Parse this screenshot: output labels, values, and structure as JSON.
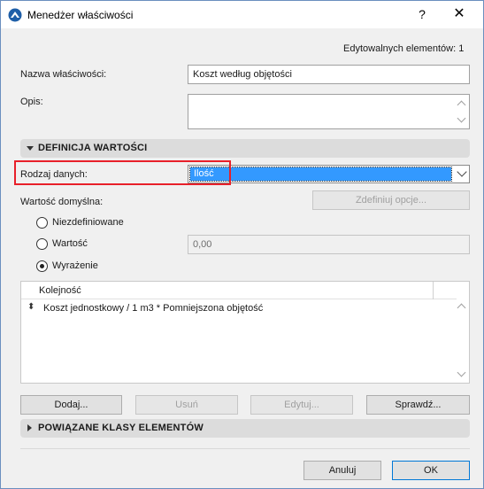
{
  "window": {
    "title": "Menedżer właściwości",
    "help_label": "?",
    "close_label": "✕"
  },
  "editable_count": "Edytowalnych elementów: 1",
  "property_name": {
    "label": "Nazwa właściwości:",
    "value": "Koszt według objętości"
  },
  "description": {
    "label": "Opis:",
    "value": ""
  },
  "section_value_definition": {
    "label": "DEFINICJA WARTOŚCI"
  },
  "data_type": {
    "label": "Rodzaj danych:",
    "value": "Ilość"
  },
  "default_value": {
    "label": "Wartość domyślna:",
    "define_options_button": "Zdefiniuj opcje...",
    "options": [
      {
        "label": "Niezdefiniowane",
        "selected": false
      },
      {
        "label": "Wartość",
        "selected": false
      },
      {
        "label": "Wyrażenie",
        "selected": true
      }
    ],
    "value_input": "0,00"
  },
  "order_list": {
    "column_header": "Kolejność",
    "rows": [
      {
        "text": "Koszt jednostkowy / 1 m3 * Pomniejszona objętość"
      }
    ]
  },
  "list_buttons": {
    "add": "Dodaj...",
    "remove": "Usuń",
    "edit": "Edytuj...",
    "check": "Sprawdź..."
  },
  "section_linked_classes": {
    "label": "POWIĄZANE KLASY ELEMENTÓW"
  },
  "footer": {
    "cancel": "Anuluj",
    "ok": "OK"
  },
  "colors": {
    "selection": "#3399ff",
    "highlight": "#e8202a"
  }
}
